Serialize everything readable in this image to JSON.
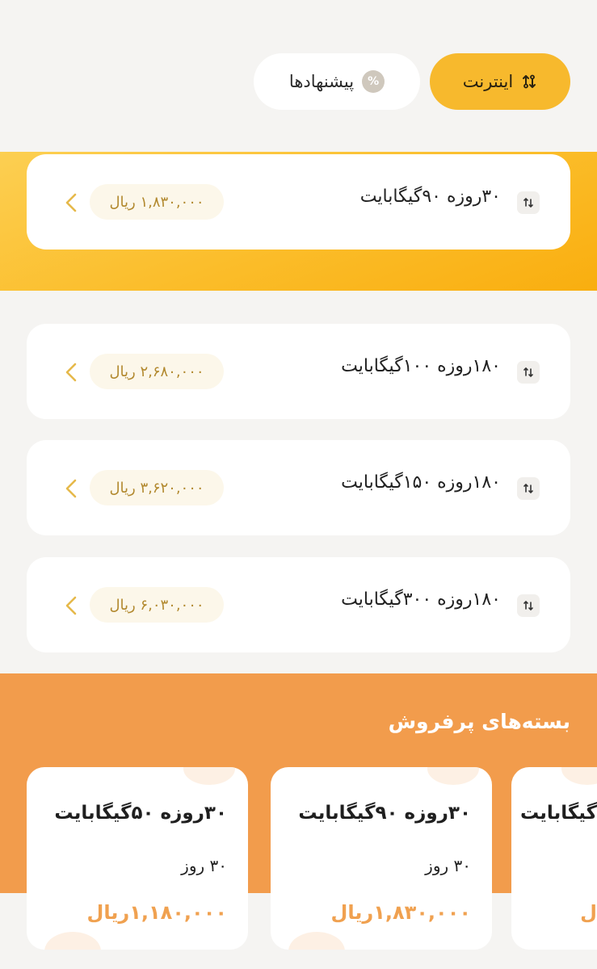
{
  "filters": {
    "internet": {
      "label": "اینترنت",
      "icon": "internet-arrows-icon",
      "active": true
    },
    "offers": {
      "label": "پیشنهادها",
      "icon": "discount-icon",
      "badge": "%"
    }
  },
  "packages": [
    {
      "title": "۳۰روزه ۹۰گیگابایت",
      "price": "۱,۸۳۰,۰۰۰ ریال",
      "highlighted": true
    },
    {
      "title": "۱۸۰روزه ۱۰۰گیگابایت",
      "price": "۲,۶۸۰,۰۰۰ ریال"
    },
    {
      "title": "۱۸۰روزه ۱۵۰گیگابایت",
      "price": "۳,۶۲۰,۰۰۰ ریال"
    },
    {
      "title": "۱۸۰روزه ۳۰۰گیگابایت",
      "price": "۶,۰۳۰,۰۰۰ ریال"
    }
  ],
  "bestsellers": {
    "title": "بسته‌های پرفروش",
    "items": [
      {
        "title": "۳۰روزه ۵۰گیگابایت",
        "duration": "۳۰ روز",
        "price": "۱,۱۸۰,۰۰۰ریال"
      },
      {
        "title": "۳۰روزه ۹۰گیگابایت",
        "duration": "۳۰ روز",
        "price": "۱,۸۳۰,۰۰۰ریال"
      },
      {
        "title": "گیگابایت",
        "duration": "",
        "price": "ل"
      }
    ]
  },
  "colors": {
    "accent_yellow": "#f7b92d",
    "accent_orange": "#f29c4c",
    "price_text": "#b2892f",
    "chevron": "#e6b94a"
  }
}
